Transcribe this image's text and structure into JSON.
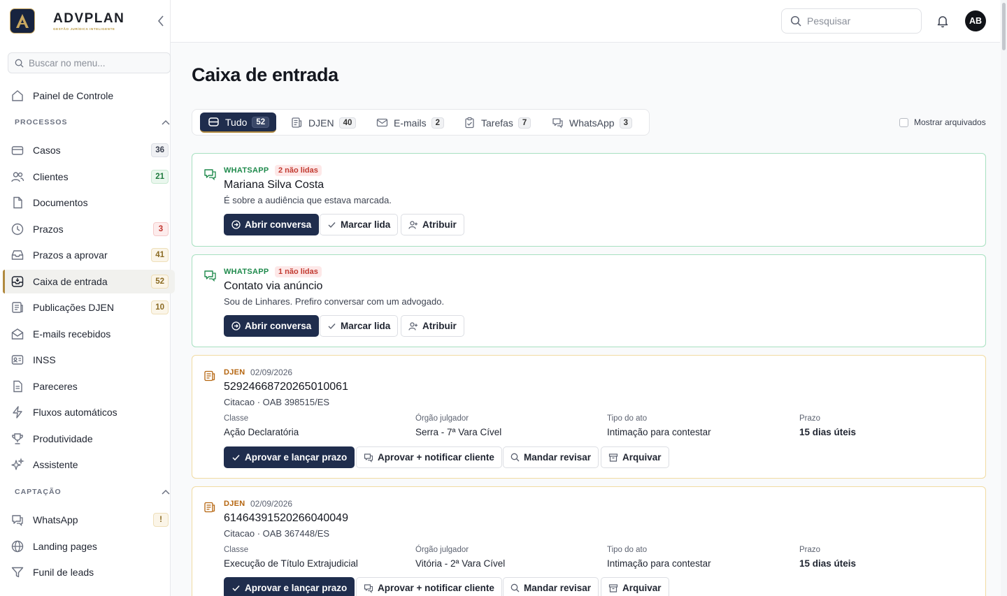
{
  "brand": {
    "name": "ADVPLAN",
    "tagline": "GESTÃO JURÍDICA INTELIGENTE"
  },
  "sidebar": {
    "search_placeholder": "Buscar no menu...",
    "top_items": [
      {
        "label": "Painel de Controle",
        "icon": "home-icon"
      }
    ],
    "sections": [
      {
        "title": "PROCESSOS",
        "items": [
          {
            "label": "Casos",
            "icon": "cases-icon",
            "badge": "36"
          },
          {
            "label": "Clientes",
            "icon": "users-icon",
            "badge": "21"
          },
          {
            "label": "Documentos",
            "icon": "document-icon"
          },
          {
            "label": "Prazos",
            "icon": "clock-icon",
            "badge": "3"
          },
          {
            "label": "Prazos a aprovar",
            "icon": "inbox-stack-icon",
            "badge": "41"
          },
          {
            "label": "Caixa de entrada",
            "icon": "inbox-icon",
            "badge": "52",
            "active": true
          },
          {
            "label": "Publicações DJEN",
            "icon": "newspaper-icon",
            "badge": "10"
          },
          {
            "label": "E-mails recebidos",
            "icon": "mail-open-icon"
          },
          {
            "label": "INSS",
            "icon": "id-card-icon"
          },
          {
            "label": "Pareceres",
            "icon": "file-text-icon"
          },
          {
            "label": "Fluxos automáticos",
            "icon": "zap-icon"
          },
          {
            "label": "Produtividade",
            "icon": "trophy-icon"
          },
          {
            "label": "Assistente",
            "icon": "sparkles-icon"
          }
        ]
      },
      {
        "title": "CAPTAÇÃO",
        "items": [
          {
            "label": "WhatsApp",
            "icon": "chat-icon",
            "badge": "!"
          },
          {
            "label": "Landing pages",
            "icon": "globe-icon"
          },
          {
            "label": "Funil de leads",
            "icon": "funnel-icon"
          }
        ]
      }
    ]
  },
  "topbar": {
    "search_placeholder": "Pesquisar",
    "avatar_initials": "AB"
  },
  "page": {
    "title": "Caixa de entrada"
  },
  "tabs": [
    {
      "label": "Tudo",
      "count": "52",
      "icon": "inbox-tray-icon",
      "active": true
    },
    {
      "label": "DJEN",
      "count": "40",
      "icon": "newspaper-icon"
    },
    {
      "label": "E-mails",
      "count": "2",
      "icon": "mail-icon"
    },
    {
      "label": "Tarefas",
      "count": "7",
      "icon": "clipboard-icon"
    },
    {
      "label": "WhatsApp",
      "count": "3",
      "icon": "chat-icon"
    }
  ],
  "show_archived_label": "Mostrar arquivados",
  "labels": {
    "whatsapp": "WHATSAPP",
    "djen": "DJEN",
    "open_conversation": "Abrir conversa",
    "mark_read": "Marcar lida",
    "assign": "Atribuir",
    "approve": "Aprovar e lançar prazo",
    "approve_notify": "Aprovar + notificar cliente",
    "send_review": "Mandar revisar",
    "archive": "Arquivar",
    "classe": "Classe",
    "orgao": "Órgão julgador",
    "tipo": "Tipo do ato",
    "prazo": "Prazo"
  },
  "items": [
    {
      "kind": "whatsapp",
      "unread": "2 não lidas",
      "name": "Mariana Silva Costa",
      "message": "É sobre a audiência que estava marcada."
    },
    {
      "kind": "whatsapp",
      "unread": "1 não lidas",
      "name": "Contato via anúncio",
      "message": "Sou de Linhares. Prefiro conversar com um advogado."
    },
    {
      "kind": "djen",
      "date": "02/09/2026",
      "number": "52924668720265010061",
      "subtitle": "Citacao · OAB 398515/ES",
      "classe": "Ação Declaratória",
      "orgao": "Serra - 7ª Vara Cível",
      "tipo": "Intimação para contestar",
      "prazo": "15 dias úteis"
    },
    {
      "kind": "djen",
      "date": "02/09/2026",
      "number": "61464391520266040049",
      "subtitle": "Citacao · OAB 367448/ES",
      "classe": "Execução de Título Extrajudicial",
      "orgao": "Vitória - 2ª Vara Cível",
      "tipo": "Intimação para contestar",
      "prazo": "15 dias úteis"
    }
  ],
  "colors": {
    "navy": "#1f2d4d",
    "gold": "#b18a3f",
    "whatsapp_green": "#1f8a4c",
    "djen_orange": "#b5650f"
  }
}
